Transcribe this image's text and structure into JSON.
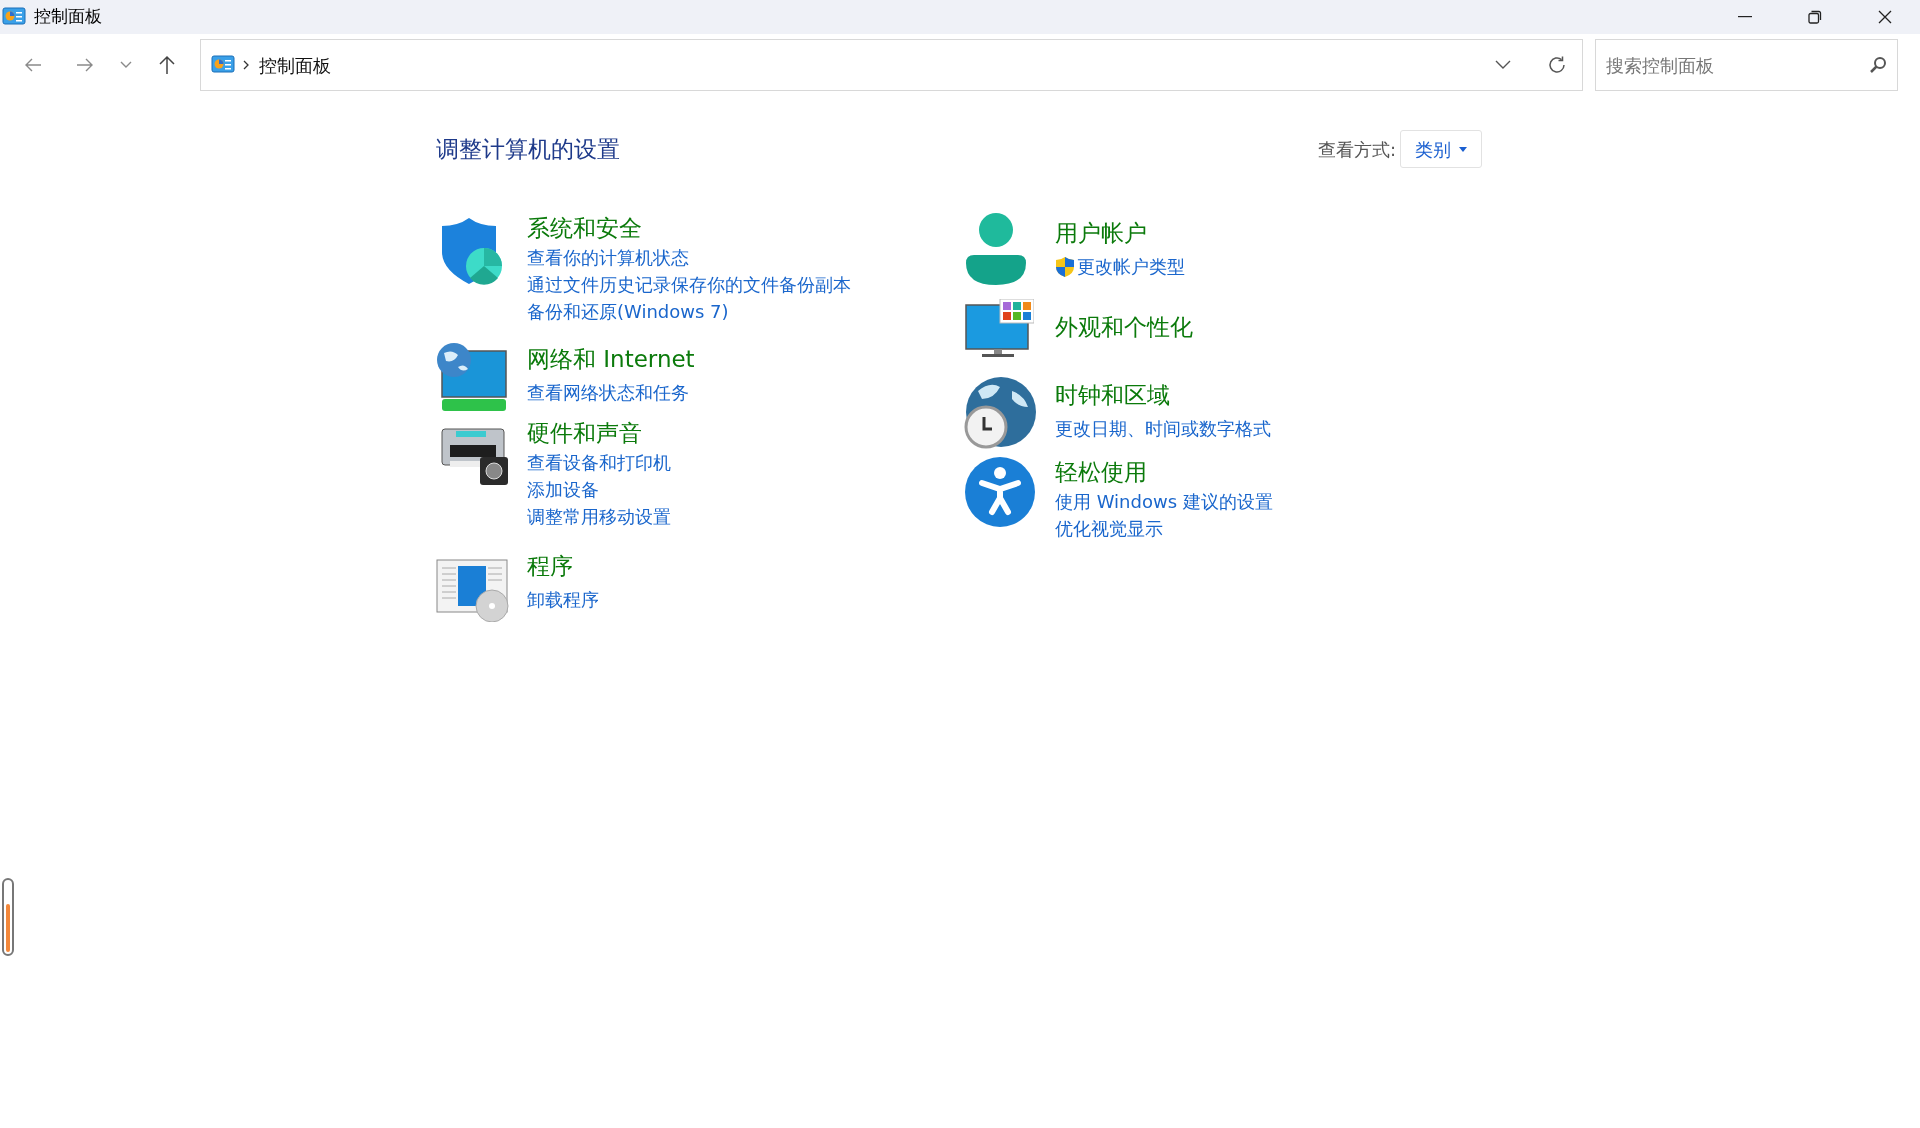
{
  "window": {
    "title": "控制面板"
  },
  "address_bar": {
    "path": "控制面板"
  },
  "search": {
    "placeholder": "搜索控制面板"
  },
  "heading": "调整计算机的设置",
  "view_by": {
    "label": "查看方式:",
    "value": "类别"
  },
  "columns": [
    [
      {
        "kind": "security",
        "title": "系统和安全",
        "links": [
          {
            "text": "查看你的计算机状态",
            "shield": false
          },
          {
            "text": "通过文件历史记录保存你的文件备份副本",
            "shield": false
          },
          {
            "text": "备份和还原(Windows 7)",
            "shield": false
          }
        ]
      },
      {
        "kind": "network",
        "title": "网络和 Internet",
        "links": [
          {
            "text": "查看网络状态和任务",
            "shield": false
          }
        ]
      },
      {
        "kind": "hardware",
        "title": "硬件和声音",
        "links": [
          {
            "text": "查看设备和打印机",
            "shield": false
          },
          {
            "text": "添加设备",
            "shield": false
          },
          {
            "text": "调整常用移动设置",
            "shield": false
          }
        ]
      },
      {
        "kind": "programs",
        "title": "程序",
        "links": [
          {
            "text": "卸载程序",
            "shield": false
          }
        ]
      }
    ],
    [
      {
        "kind": "accounts",
        "title": "用户帐户",
        "links": [
          {
            "text": "更改帐户类型",
            "shield": true
          }
        ]
      },
      {
        "kind": "appearance",
        "title": "外观和个性化"
      },
      {
        "kind": "clock",
        "title": "时钟和区域",
        "links": [
          {
            "text": "更改日期、时间或数字格式",
            "shield": false
          }
        ]
      },
      {
        "kind": "ease",
        "title": "轻松使用",
        "links": [
          {
            "text": "使用 Windows 建议的设置",
            "shield": false
          },
          {
            "text": "优化视觉显示",
            "shield": false
          }
        ]
      }
    ]
  ]
}
